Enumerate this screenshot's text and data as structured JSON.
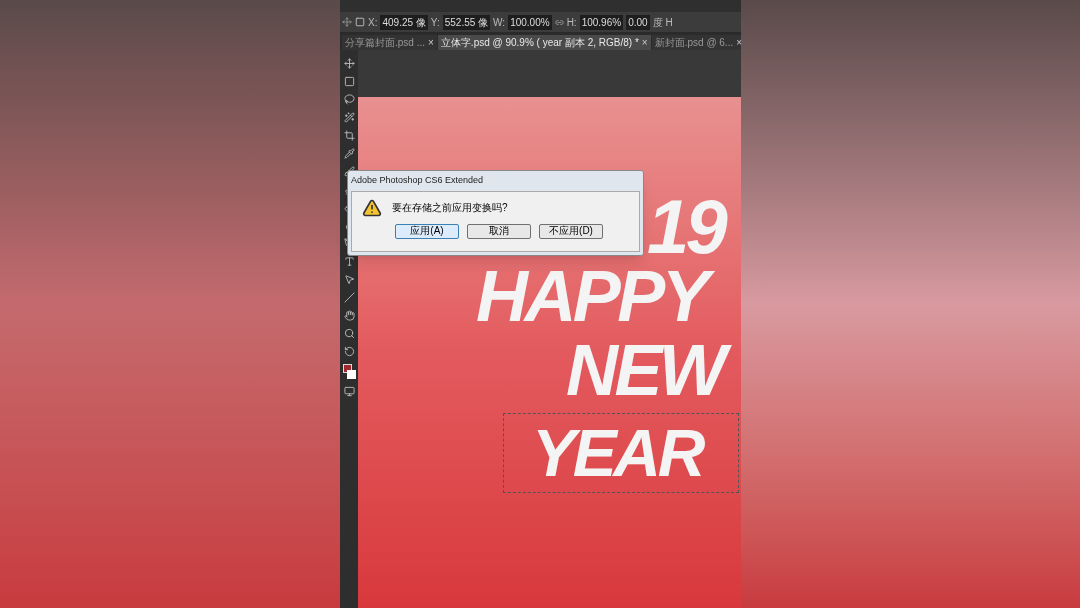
{
  "options_bar": {
    "x_label": "X:",
    "x_value": "409.25 像",
    "y_label": "Y:",
    "y_value": "552.55 像",
    "w_label": "W:",
    "w_value": "100.00%",
    "h_label": "H:",
    "h_value": "100.96%",
    "angle_value": "0.00",
    "angle_unit": "度",
    "edge_label": "H"
  },
  "tabs": [
    {
      "label": "分享篇封面.psd ...",
      "close": "×",
      "selected": false
    },
    {
      "label": "立体字.psd @ 90.9% ( year 副本 2, RGB/8) *",
      "close": "×",
      "selected": true
    },
    {
      "label": "新封面.psd @ 6...",
      "close": "×",
      "selected": false
    }
  ],
  "poster": {
    "lines": [
      "19",
      "HAPPY",
      "NEW",
      "YEAR"
    ]
  },
  "dialog": {
    "title": "Adobe Photoshop CS6 Extended",
    "message": "要在存储之前应用变换吗?",
    "buttons": [
      {
        "label": "应用(A)",
        "selected": true
      },
      {
        "label": "取消",
        "selected": false
      },
      {
        "label": "不应用(D)",
        "selected": false
      }
    ]
  }
}
